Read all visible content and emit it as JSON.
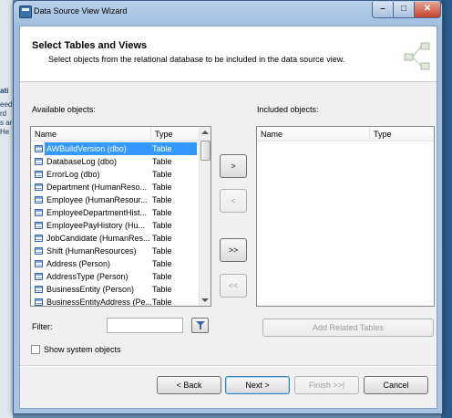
{
  "background": {
    "left_fragments": [
      "ati",
      "eed",
      "rd",
      "s ar",
      "He"
    ]
  },
  "window": {
    "title": "Data Source View Wizard",
    "controls": {
      "minimize": "–",
      "maximize": "□",
      "close": "✕"
    }
  },
  "header": {
    "title": "Select Tables and Views",
    "subtitle": "Select objects from the relational database to be included in the data source view."
  },
  "available": {
    "label": "Available objects:",
    "columns": [
      "Name",
      "Type"
    ],
    "rows": [
      {
        "name": "AWBuildVersion (dbo)",
        "type": "Table",
        "selected": true
      },
      {
        "name": "DatabaseLog (dbo)",
        "type": "Table"
      },
      {
        "name": "ErrorLog (dbo)",
        "type": "Table"
      },
      {
        "name": "Department (HumanReso...",
        "type": "Table"
      },
      {
        "name": "Employee (HumanResour...",
        "type": "Table"
      },
      {
        "name": "EmployeeDepartmentHist...",
        "type": "Table"
      },
      {
        "name": "EmployeePayHistory (Hu...",
        "type": "Table"
      },
      {
        "name": "JobCandidate (HumanRes...",
        "type": "Table"
      },
      {
        "name": "Shift (HumanResources)",
        "type": "Table"
      },
      {
        "name": "Address (Person)",
        "type": "Table"
      },
      {
        "name": "AddressType (Person)",
        "type": "Table"
      },
      {
        "name": "BusinessEntity (Person)",
        "type": "Table"
      },
      {
        "name": "BusinessEntityAddress (Pe...",
        "type": "Table"
      }
    ]
  },
  "included": {
    "label": "Included objects:",
    "columns": [
      "Name",
      "Type"
    ]
  },
  "transfer": {
    "add": ">",
    "remove": "<",
    "add_all": ">>",
    "remove_all": "<<"
  },
  "filter": {
    "label": "Filter:",
    "value": ""
  },
  "add_related_label": "Add Related Tables",
  "show_system_label": "Show system objects",
  "footer": {
    "back": "< Back",
    "next": "Next >",
    "finish": "Finish >>|",
    "cancel": "Cancel"
  }
}
